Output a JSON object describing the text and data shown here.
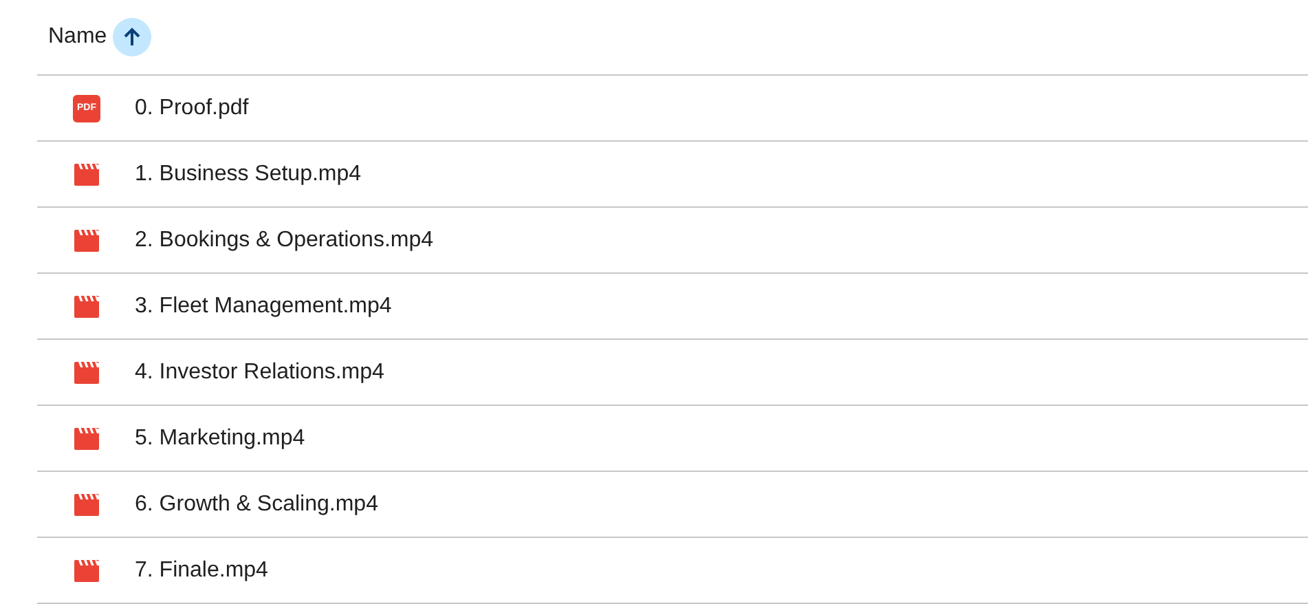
{
  "header": {
    "label": "Name",
    "sort_ascending": true
  },
  "files": [
    {
      "kind": "pdf",
      "badge": "PDF",
      "name": "0. Proof.pdf"
    },
    {
      "kind": "video",
      "name": "1. Business Setup.mp4"
    },
    {
      "kind": "video",
      "name": "2. Bookings & Operations.mp4"
    },
    {
      "kind": "video",
      "name": "3. Fleet Management.mp4"
    },
    {
      "kind": "video",
      "name": "4. Investor Relations.mp4"
    },
    {
      "kind": "video",
      "name": "5. Marketing.mp4"
    },
    {
      "kind": "video",
      "name": "6. Growth & Scaling.mp4"
    },
    {
      "kind": "video",
      "name": "7. Finale.mp4"
    }
  ]
}
